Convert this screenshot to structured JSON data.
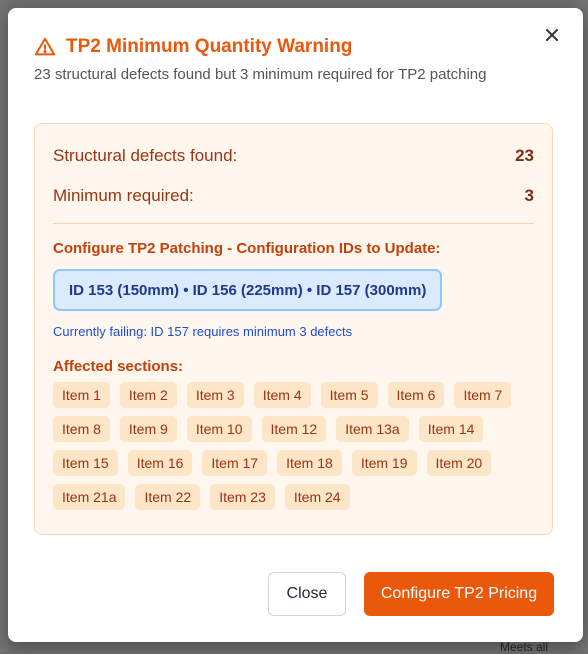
{
  "background": {
    "footer_text": "Meets all"
  },
  "modal": {
    "title": "TP2 Minimum Quantity Warning",
    "subtitle": "23 structural defects found but 3 minimum required for TP2 patching",
    "close_icon": "close-icon",
    "warning_icon": "warning-triangle-icon"
  },
  "summary": {
    "defects_label": "Structural defects found:",
    "defects_value": "23",
    "minimum_label": "Minimum required:",
    "minimum_value": "3"
  },
  "config": {
    "heading": "Configure TP2 Patching - Configuration IDs to Update:",
    "ids": "ID 153 (150mm) • ID 156 (225mm) • ID 157 (300mm)",
    "failing_note": "Currently failing: ID 157 requires minimum 3 defects"
  },
  "affected": {
    "heading": "Affected sections:",
    "rows": [
      [
        "Item 1",
        "Item 2",
        "Item 3",
        "Item 4",
        "Item 5",
        "Item 6",
        "Item 7"
      ],
      [
        "Item 8",
        "Item 9",
        "Item 10",
        "Item 12",
        "Item 13a",
        "Item 14"
      ],
      [
        "Item 15",
        "Item 16",
        "Item 17",
        "Item 18",
        "Item 19",
        "Item 20"
      ],
      [
        "Item 21a",
        "Item 22",
        "Item 23",
        "Item 24"
      ]
    ]
  },
  "actions": {
    "close_label": "Close",
    "primary_label": "Configure TP2 Pricing"
  },
  "colors": {
    "accent": "#ea580c",
    "panel_bg": "#fff6ed",
    "id_box_bg": "#dbeafe",
    "link_blue": "#1d4ed8"
  }
}
